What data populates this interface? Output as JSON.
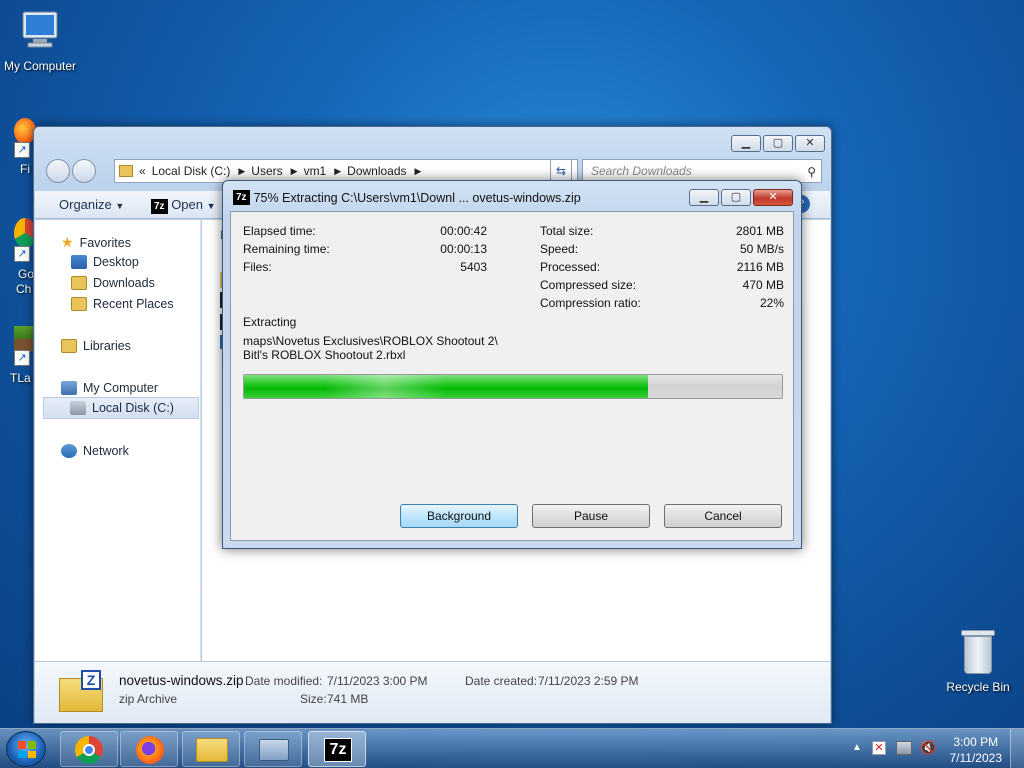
{
  "desktop": {
    "icons": [
      {
        "label": "My Computer"
      },
      {
        "label": "Recycle Bin"
      }
    ],
    "partial_labels": [
      "Fi",
      "Go",
      "Ch",
      "TLa"
    ]
  },
  "explorer": {
    "address": [
      "«",
      "Local Disk (C:)",
      "Users",
      "vm1",
      "Downloads"
    ],
    "search_placeholder": "Search Downloads",
    "toolbar": {
      "organize": "Organize",
      "open": "Open"
    },
    "nav": {
      "favorites": "Favorites",
      "desktop": "Desktop",
      "downloads": "Downloads",
      "recent": "Recent Places",
      "libraries": "Libraries",
      "my_computer": "My Computer",
      "local_disk": "Local Disk (C:)",
      "network": "Network"
    },
    "content_partial": "N",
    "details": {
      "file_name": "novetus-windows.zip",
      "file_type": "zip Archive",
      "date_modified_label": "Date modified:",
      "date_modified": "7/11/2023 3:00 PM",
      "size_label": "Size:",
      "size": "741 MB",
      "date_created_label": "Date created:",
      "date_created": "7/11/2023 2:59 PM"
    }
  },
  "dialog": {
    "title": "75% Extracting C:\\Users\\vm1\\Downl ... ovetus-windows.zip",
    "logo": "7z",
    "left_stats": [
      {
        "label": "Elapsed time:",
        "value": "00:00:42"
      },
      {
        "label": "Remaining time:",
        "value": "00:00:13"
      },
      {
        "label": "Files:",
        "value": "5403"
      }
    ],
    "right_stats": [
      {
        "label": "Total size:",
        "value": "2801 MB"
      },
      {
        "label": "Speed:",
        "value": "50 MB/s"
      },
      {
        "label": "Processed:",
        "value": "2116 MB"
      },
      {
        "label": "Compressed size:",
        "value": "470 MB"
      },
      {
        "label": "Compression ratio:",
        "value": "22%"
      }
    ],
    "extracting_label": "Extracting",
    "current_path_1": "maps\\Novetus Exclusives\\ROBLOX Shootout 2\\",
    "current_path_2": "Bitl's ROBLOX Shootout 2.rbxl",
    "progress_fraction": 0.75,
    "buttons": {
      "background": "Background",
      "pause": "Pause",
      "cancel": "Cancel"
    }
  },
  "taskbar": {
    "clock_time": "3:00 PM",
    "clock_date": "7/11/2023",
    "active_logo": "7z"
  }
}
